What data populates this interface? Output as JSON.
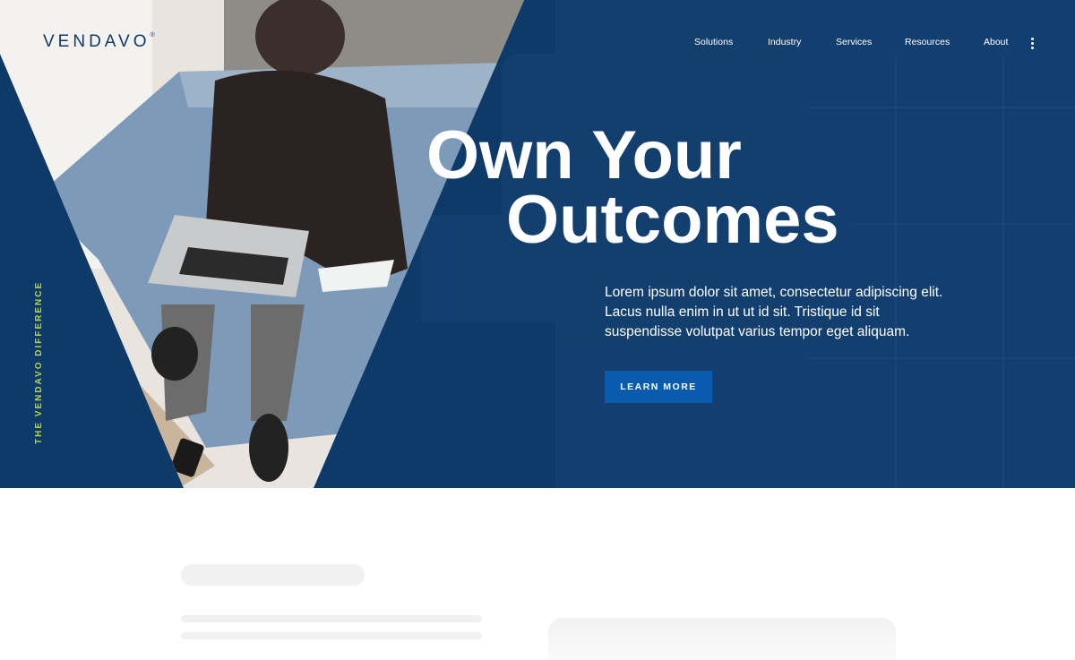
{
  "brand": {
    "logo_text": "VENDAVO",
    "logo_mark": "®"
  },
  "nav": {
    "items": [
      {
        "label": "Solutions"
      },
      {
        "label": "Industry"
      },
      {
        "label": "Services"
      },
      {
        "label": "Resources"
      },
      {
        "label": "About"
      }
    ],
    "more_icon": "kebab-menu-icon"
  },
  "hero": {
    "side_label": "THE VENDAVO DIFFERENCE",
    "headline_line1": "Own Your",
    "headline_line2": "Outcomes",
    "lead": "Lorem ipsum dolor sit amet, consectetur adipiscing elit. Lacus nulla enim in ut ut id sit. Tristique id sit suspendisse volutpat varius tempor eget aliquam.",
    "cta_label": "LEARN MORE",
    "photo_subject": "man seated on sofa working on laptop"
  },
  "colors": {
    "navy": "#0e3a69",
    "cta_blue": "#0a5bb0",
    "accent_green": "#b7d43a",
    "placeholder_gray": "#f1f1f1"
  }
}
